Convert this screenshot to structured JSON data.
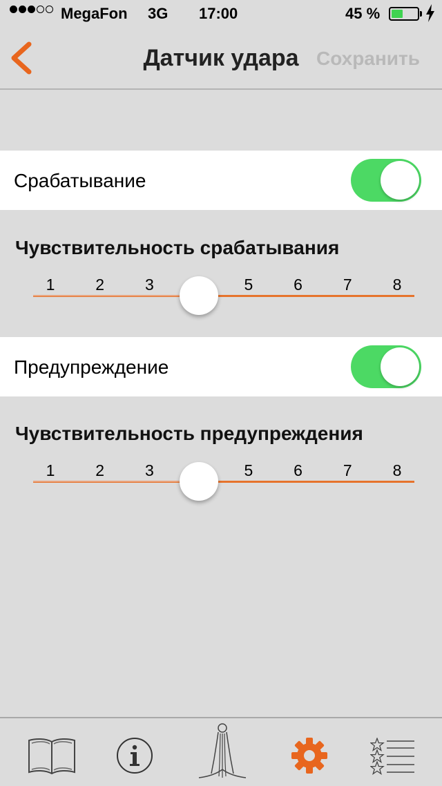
{
  "status_bar": {
    "signal_strength": 3,
    "signal_total": 5,
    "carrier": "MegaFon",
    "network": "3G",
    "time": "17:00",
    "battery_percent_text": "45 %",
    "battery_level": 0.45,
    "battery_color": "#3fd351"
  },
  "nav": {
    "back_icon": "chevron-left-icon",
    "title": "Датчик удара",
    "save_label": "Сохранить"
  },
  "settings": {
    "trigger": {
      "label": "Срабатывание",
      "enabled": true
    },
    "trigger_sensitivity": {
      "title": "Чувствительность срабатывания",
      "ticks": [
        "1",
        "2",
        "3",
        "5",
        "6",
        "7",
        "8"
      ],
      "value": 4
    },
    "warning": {
      "label": "Предупреждение",
      "enabled": true
    },
    "warning_sensitivity": {
      "title": "Чувствительность предупреждения",
      "ticks": [
        "1",
        "2",
        "3",
        "5",
        "6",
        "7",
        "8"
      ],
      "value": 4
    }
  },
  "tab_bar": {
    "tabs": [
      {
        "icon": "book-icon",
        "active": false
      },
      {
        "icon": "info-icon",
        "active": false
      },
      {
        "icon": "figure-icon",
        "active": false
      },
      {
        "icon": "gear-icon",
        "active": true
      },
      {
        "icon": "star-list-icon",
        "active": false
      }
    ]
  },
  "colors": {
    "accent": "#e8661e",
    "toggle_on": "#4cd964",
    "background": "#dcdcdc"
  }
}
